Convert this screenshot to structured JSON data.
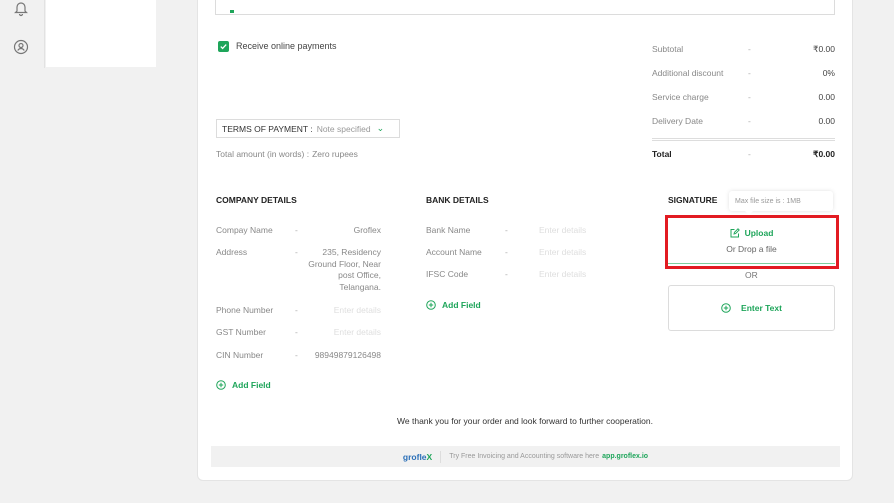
{
  "sidebar": {
    "icons": [
      {
        "name": "bell-icon"
      },
      {
        "name": "user-circle-icon"
      }
    ]
  },
  "payments": {
    "receive_online": {
      "label": "Receive online payments",
      "checked": true
    },
    "terms": {
      "label": "TERMS OF PAYMENT :",
      "value": "Note specified"
    },
    "amount_in_words": {
      "label": "Total amount (in words) :",
      "value": "Zero rupees"
    }
  },
  "summary": {
    "rows": [
      {
        "label": "Subtotal",
        "sep": "-",
        "value": "₹0.00"
      },
      {
        "label": "Additional discount",
        "sep": "-",
        "value": "0%"
      },
      {
        "label": "Service charge",
        "sep": "-",
        "value": "0.00"
      },
      {
        "label": "Delivery Date",
        "sep": "-",
        "value": "0.00"
      }
    ],
    "total": {
      "label": "Total",
      "sep": "-",
      "value": "₹0.00"
    }
  },
  "company": {
    "title": "COMPANY DETAILS",
    "fields": [
      {
        "label": "Compay Name",
        "sep": "-",
        "value": "Groflex"
      },
      {
        "label": "Address",
        "sep": "-",
        "value": "235, Residency Ground Floor, Near post Office, Telangana."
      },
      {
        "label": "Phone Number",
        "sep": "-",
        "placeholder": "Enter details"
      },
      {
        "label": "GST Number",
        "sep": "-",
        "placeholder": "Enter details"
      },
      {
        "label": "CIN Number",
        "sep": "-",
        "value": "98949879126498"
      }
    ],
    "add_field": "Add Field"
  },
  "bank": {
    "title": "BANK DETAILS",
    "fields": [
      {
        "label": "Bank Name",
        "sep": "-",
        "placeholder": "Enter details"
      },
      {
        "label": "Account Name",
        "sep": "-",
        "placeholder": "Enter details"
      },
      {
        "label": "IFSC Code",
        "sep": "-",
        "placeholder": "Enter details"
      }
    ],
    "add_field": "Add Field"
  },
  "signature": {
    "title": "SIGNATURE",
    "tooltip": "Max file size is : 1MB",
    "upload_label": "Upload",
    "drop_label": "Or Drop a file",
    "or_label": "OR",
    "enter_text_label": "Enter Text",
    "highlight_color": "#e21b22"
  },
  "footer": {
    "thanks": "We thank you for your order and look forward to further cooperation.",
    "brand_main": "grofle",
    "brand_x": "X",
    "promo": "Try Free Invoicing and Accounting software here",
    "link": "app.groflex.io"
  },
  "colors": {
    "accent": "#1ea55a",
    "brand_blue": "#2a6fb8"
  }
}
